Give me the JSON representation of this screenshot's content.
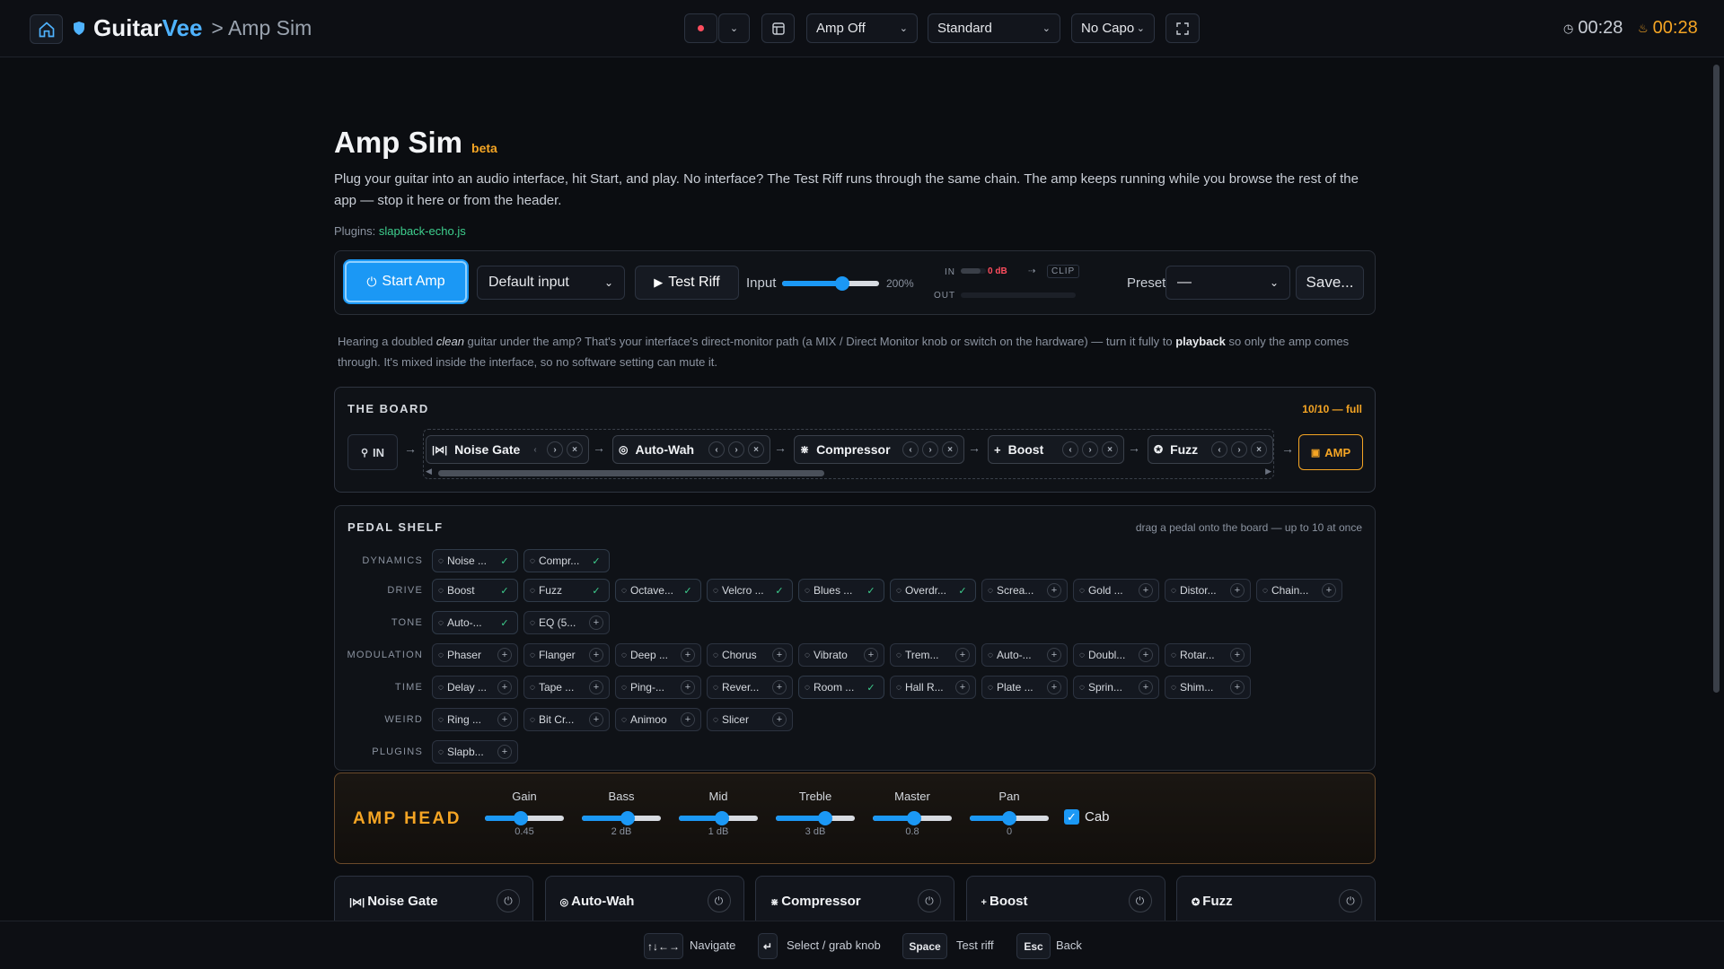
{
  "header": {
    "brand_prefix": "Guitar",
    "brand_suffix": "Vee",
    "crumb": "> Amp Sim",
    "amp_state": "Amp Off",
    "tuning": "Standard",
    "capo": "No Capo",
    "timer_session": "00:28",
    "timer_practice": "00:28"
  },
  "page": {
    "title": "Amp Sim",
    "badge": "beta",
    "description": "Plug your guitar into an audio interface, hit Start, and play. No interface? The Test Riff runs through the same chain. The amp keeps running while you browse the rest of the app — stop it here or from the header.",
    "plugins_label": "Plugins:",
    "plugins_value": "slapback-echo.js"
  },
  "controls": {
    "start_label": "Start Amp",
    "input_select": "Default input",
    "test_riff_label": "Test Riff",
    "input_label": "Input",
    "input_gain": "200%",
    "input_gain_fraction": 0.62,
    "meter_in": "IN",
    "meter_db": "0 dB",
    "meter_clip": "CLIP",
    "meter_out": "OUT",
    "preset_label": "Preset",
    "preset_value": "—",
    "save_label": "Save..."
  },
  "hint": {
    "part1": "Hearing a doubled ",
    "em": "clean",
    "part2": " guitar under the amp? That's your interface's direct-monitor path (a MIX / Direct Monitor knob or switch on the hardware) — turn it fully to ",
    "strong": "playback",
    "part3": " so only the amp comes through. It's mixed inside the interface, so no software setting can mute it."
  },
  "board": {
    "title": "THE BOARD",
    "count": "10/10 — full",
    "in_label": "IN",
    "amp_label": "AMP",
    "pedals": [
      "Noise Gate",
      "Auto-Wah",
      "Compressor",
      "Boost",
      "Fuzz"
    ]
  },
  "shelf": {
    "title": "PEDAL SHELF",
    "hint": "drag a pedal onto the board — up to 10 at once",
    "categories": [
      {
        "name": "DYNAMICS",
        "chips": [
          {
            "label": "Noise ...",
            "on": true
          },
          {
            "label": "Compr...",
            "on": true
          }
        ]
      },
      {
        "name": "DRIVE",
        "chips": [
          {
            "label": "Boost",
            "on": true
          },
          {
            "label": "Fuzz",
            "on": true
          },
          {
            "label": "Octave...",
            "on": true
          },
          {
            "label": "Velcro ...",
            "on": true
          },
          {
            "label": "Blues ...",
            "on": true
          },
          {
            "label": "Overdr...",
            "on": true
          },
          {
            "label": "Screa...",
            "on": false
          },
          {
            "label": "Gold ...",
            "on": false
          },
          {
            "label": "Distor...",
            "on": false
          },
          {
            "label": "Chain...",
            "on": false
          }
        ]
      },
      {
        "name": "TONE",
        "chips": [
          {
            "label": "Auto-...",
            "on": true
          },
          {
            "label": "EQ (5...",
            "on": false
          }
        ]
      },
      {
        "name": "MODULATION",
        "chips": [
          {
            "label": "Phaser",
            "on": false
          },
          {
            "label": "Flanger",
            "on": false
          },
          {
            "label": "Deep ...",
            "on": false
          },
          {
            "label": "Chorus",
            "on": false
          },
          {
            "label": "Vibrato",
            "on": false
          },
          {
            "label": "Trem...",
            "on": false
          },
          {
            "label": "Auto-...",
            "on": false
          },
          {
            "label": "Doubl...",
            "on": false
          },
          {
            "label": "Rotar...",
            "on": false
          }
        ]
      },
      {
        "name": "TIME",
        "chips": [
          {
            "label": "Delay ...",
            "on": false
          },
          {
            "label": "Tape ...",
            "on": false
          },
          {
            "label": "Ping-...",
            "on": false
          },
          {
            "label": "Rever...",
            "on": false
          },
          {
            "label": "Room ...",
            "on": true
          },
          {
            "label": "Hall R...",
            "on": false
          },
          {
            "label": "Plate ...",
            "on": false
          },
          {
            "label": "Sprin...",
            "on": false
          },
          {
            "label": "Shim...",
            "on": false
          }
        ]
      },
      {
        "name": "WEIRD",
        "chips": [
          {
            "label": "Ring ...",
            "on": false
          },
          {
            "label": "Bit Cr...",
            "on": false
          },
          {
            "label": "Animoo",
            "on": false
          },
          {
            "label": "Slicer",
            "on": false
          }
        ]
      },
      {
        "name": "PLUGINS",
        "chips": [
          {
            "label": "Slapb...",
            "on": false
          }
        ]
      }
    ]
  },
  "amp_head": {
    "title": "AMP HEAD",
    "knobs": [
      {
        "label": "Gain",
        "value": "0.45",
        "level": 0.45
      },
      {
        "label": "Bass",
        "value": "2 dB",
        "level": 0.58
      },
      {
        "label": "Mid",
        "value": "1 dB",
        "level": 0.54
      },
      {
        "label": "Treble",
        "value": "3 dB",
        "level": 0.62
      },
      {
        "label": "Master",
        "value": "0.8",
        "level": 0.52
      },
      {
        "label": "Pan",
        "value": "0",
        "level": 0.5
      }
    ],
    "cab_label": "Cab",
    "cab_checked": true
  },
  "cards": [
    "Noise Gate",
    "Auto-Wah",
    "Compressor",
    "Boost",
    "Fuzz"
  ],
  "footer": [
    {
      "key": "↑↓←→",
      "desc": "Navigate"
    },
    {
      "key": "↵",
      "desc": "Select / grab knob"
    },
    {
      "key": "Space",
      "desc": "Test riff"
    },
    {
      "key": "Esc",
      "desc": "Back"
    }
  ],
  "colors": {
    "accent": "#1b98f5",
    "amber": "#f5a524",
    "green": "#3ecf8e",
    "record": "#ff4d5e"
  }
}
